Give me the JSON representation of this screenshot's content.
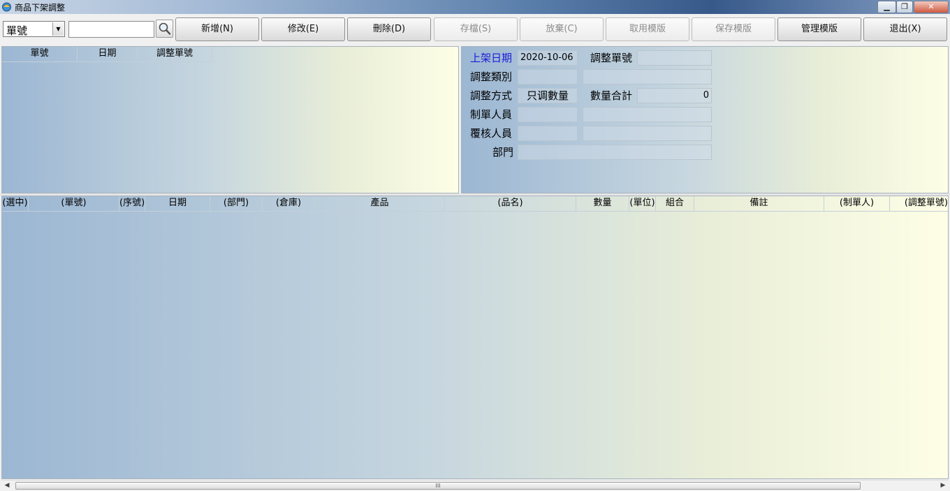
{
  "window": {
    "title": "商品下架調整",
    "minimize": "▁",
    "restore": "❐",
    "close": "✕"
  },
  "toolbar": {
    "search_field": "單號",
    "search_value": "",
    "buttons": {
      "add": "新增(N)",
      "edit": "修改(E)",
      "delete": "刪除(D)",
      "save": "存檔(S)",
      "discard": "放棄(C)",
      "use_template": "取用模版",
      "save_template": "保存模版",
      "manage_template": "管理模版",
      "exit": "退出(X)"
    }
  },
  "list_panel": {
    "columns": [
      "單號",
      "日期",
      "調整單號"
    ]
  },
  "form": {
    "shelf_date_label": "上架日期",
    "shelf_date": "2020-10-06",
    "adjust_no_label": "調整單號",
    "adjust_no": "",
    "adjust_type_label": "調整類別",
    "adjust_type_code": "",
    "adjust_type_name": "",
    "adjust_method_label": "調整方式",
    "adjust_method": "只调數量",
    "qty_total_label": "數量合計",
    "qty_total": "0",
    "creator_label": "制單人員",
    "creator_code": "",
    "creator_name": "",
    "reviewer_label": "覆核人員",
    "reviewer_code": "",
    "reviewer_name": "",
    "dept_label": "部門",
    "dept": ""
  },
  "detail_grid": {
    "columns": [
      "(選中)",
      "(單號)",
      "(序號)",
      "日期",
      "(部門)",
      "(倉庫)",
      "產品",
      "(品名)",
      "數量",
      "(單位)",
      "組合",
      "備註",
      "(制單人)",
      "(調整單號)"
    ]
  },
  "scrollbar": {
    "left": "◀",
    "right": "▶",
    "grip": "III"
  },
  "colors": {
    "label_highlight": "#1b1bd6"
  }
}
